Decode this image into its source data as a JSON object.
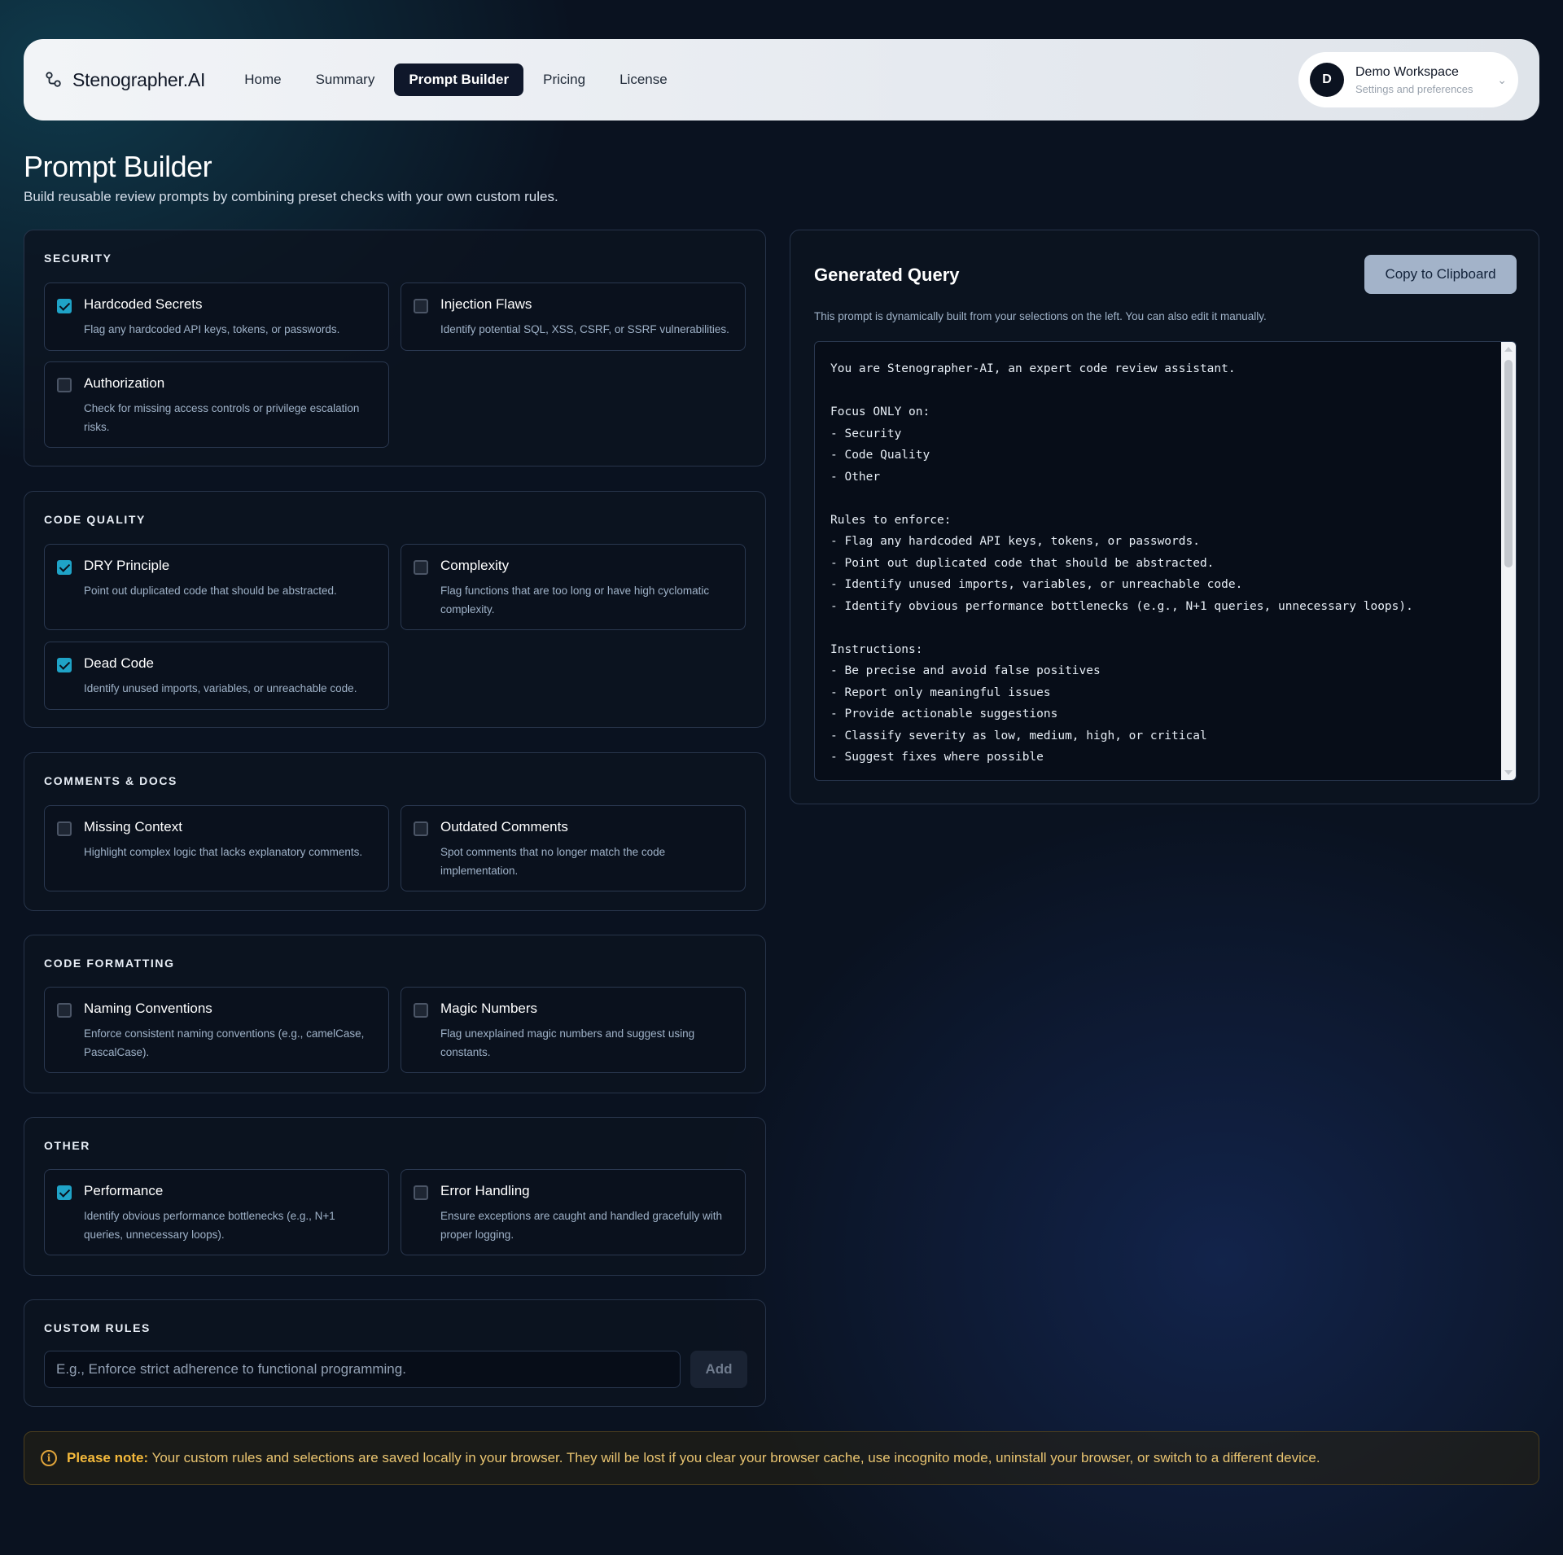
{
  "header": {
    "brand": "Stenographer.AI",
    "nav": [
      "Home",
      "Summary",
      "Prompt Builder",
      "Pricing",
      "License"
    ],
    "active_nav": "Prompt Builder",
    "workspace": {
      "avatar": "D",
      "title": "Demo Workspace",
      "subtitle": "Settings and preferences"
    }
  },
  "page": {
    "title": "Prompt Builder",
    "subtitle": "Build reusable review prompts by combining preset checks with your own custom rules."
  },
  "sections": {
    "security": {
      "title": "SECURITY",
      "options": [
        {
          "title": "Hardcoded Secrets",
          "desc": "Flag any hardcoded API keys, tokens, or passwords.",
          "checked": true
        },
        {
          "title": "Injection Flaws",
          "desc": "Identify potential SQL, XSS, CSRF, or SSRF vulnerabilities.",
          "checked": false
        },
        {
          "title": "Authorization",
          "desc": "Check for missing access controls or privilege escalation risks.",
          "checked": false
        }
      ]
    },
    "code_quality": {
      "title": "CODE QUALITY",
      "options": [
        {
          "title": "DRY Principle",
          "desc": "Point out duplicated code that should be abstracted.",
          "checked": true
        },
        {
          "title": "Complexity",
          "desc": "Flag functions that are too long or have high cyclomatic complexity.",
          "checked": false
        },
        {
          "title": "Dead Code",
          "desc": "Identify unused imports, variables, or unreachable code.",
          "checked": true
        }
      ]
    },
    "comments_docs": {
      "title": "COMMENTS & DOCS",
      "options": [
        {
          "title": "Missing Context",
          "desc": "Highlight complex logic that lacks explanatory comments.",
          "checked": false
        },
        {
          "title": "Outdated Comments",
          "desc": "Spot comments that no longer match the code implementation.",
          "checked": false
        }
      ]
    },
    "code_formatting": {
      "title": "CODE FORMATTING",
      "options": [
        {
          "title": "Naming Conventions",
          "desc": "Enforce consistent naming conventions (e.g., camelCase, PascalCase).",
          "checked": false
        },
        {
          "title": "Magic Numbers",
          "desc": "Flag unexplained magic numbers and suggest using constants.",
          "checked": false
        }
      ]
    },
    "other": {
      "title": "OTHER",
      "options": [
        {
          "title": "Performance",
          "desc": "Identify obvious performance bottlenecks (e.g., N+1 queries, unnecessary loops).",
          "checked": true
        },
        {
          "title": "Error Handling",
          "desc": "Ensure exceptions are caught and handled gracefully with proper logging.",
          "checked": false
        }
      ]
    }
  },
  "custom_rules": {
    "title": "CUSTOM RULES",
    "placeholder": "E.g., Enforce strict adherence to functional programming.",
    "add_label": "Add"
  },
  "generated": {
    "title": "Generated Query",
    "copy_label": "Copy to Clipboard",
    "description": "This prompt is dynamically built from your selections on the left. You can also edit it manually.",
    "query": "You are Stenographer-AI, an expert code review assistant.\n\nFocus ONLY on:\n- Security\n- Code Quality\n- Other\n\nRules to enforce:\n- Flag any hardcoded API keys, tokens, or passwords.\n- Point out duplicated code that should be abstracted.\n- Identify unused imports, variables, or unreachable code.\n- Identify obvious performance bottlenecks (e.g., N+1 queries, unnecessary loops).\n\nInstructions:\n- Be precise and avoid false positives\n- Report only meaningful issues\n- Provide actionable suggestions\n- Classify severity as low, medium, high, or critical\n- Suggest fixes where possible"
  },
  "note": {
    "icon": "info-icon",
    "label": "Please note:",
    "text": " Your custom rules and selections are saved locally in your browser. They will be lost if you clear your browser cache, use incognito mode, uninstall your browser, or switch to a different device."
  },
  "colors": {
    "accent_check": "#1fa3c7",
    "active_nav_bg": "#0f172a",
    "note_text": "#e9c470"
  }
}
